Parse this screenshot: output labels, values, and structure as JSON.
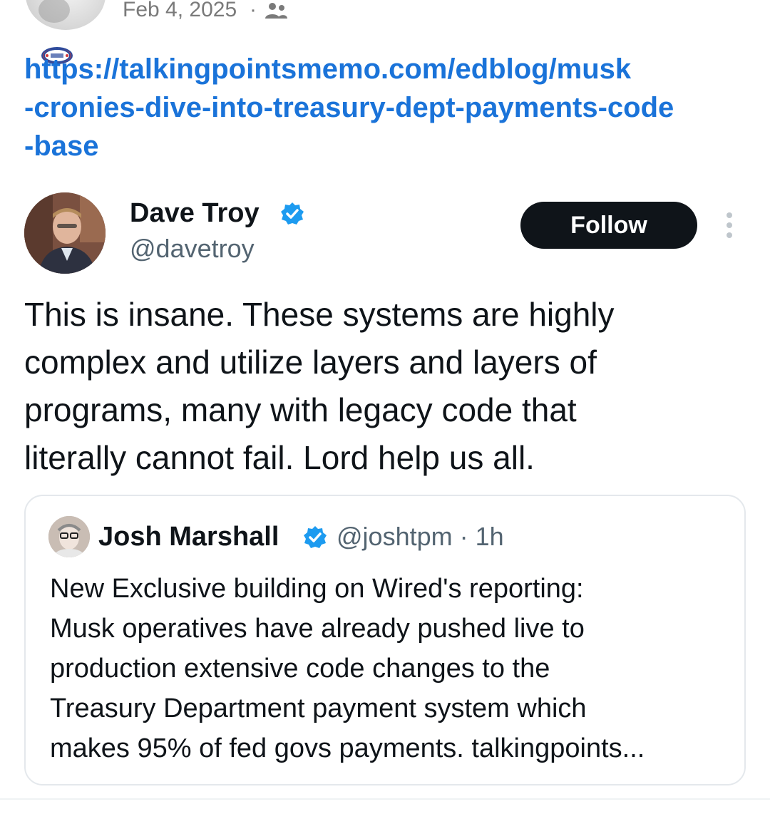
{
  "post": {
    "date": "Feb 4, 2025",
    "separator": "·",
    "audience_icon": "people-icon",
    "link_lines": [
      "https://talkingpointsmemo.com/edblog/musk",
      "-cronies-dive-into-treasury-dept-payments-code",
      "-base"
    ]
  },
  "tweet": {
    "author": "Dave Troy",
    "handle": "@davetroy",
    "verified_icon": "verified-badge-icon",
    "follow_label": "Follow",
    "more_icon": "more-vertical-icon",
    "text_lines": [
      "This is insane. These systems are highly",
      "complex and utilize layers and layers of",
      "programs, many with legacy code that",
      "literally cannot fail. Lord help us all."
    ]
  },
  "quote": {
    "author": "Josh Marshall",
    "meta": "@joshtpm · 1h",
    "text_lines": [
      "New Exclusive building on Wired's reporting:",
      "Musk operatives have already pushed live to",
      "production extensive code changes to the",
      "Treasury Department payment system which",
      "makes 95% of fed govs payments. talkingpoints..."
    ]
  },
  "colors": {
    "link": "#1a73d9",
    "verified": "#1d9bf0",
    "follow_bg": "#0f1419",
    "secondary_text": "#536471"
  }
}
